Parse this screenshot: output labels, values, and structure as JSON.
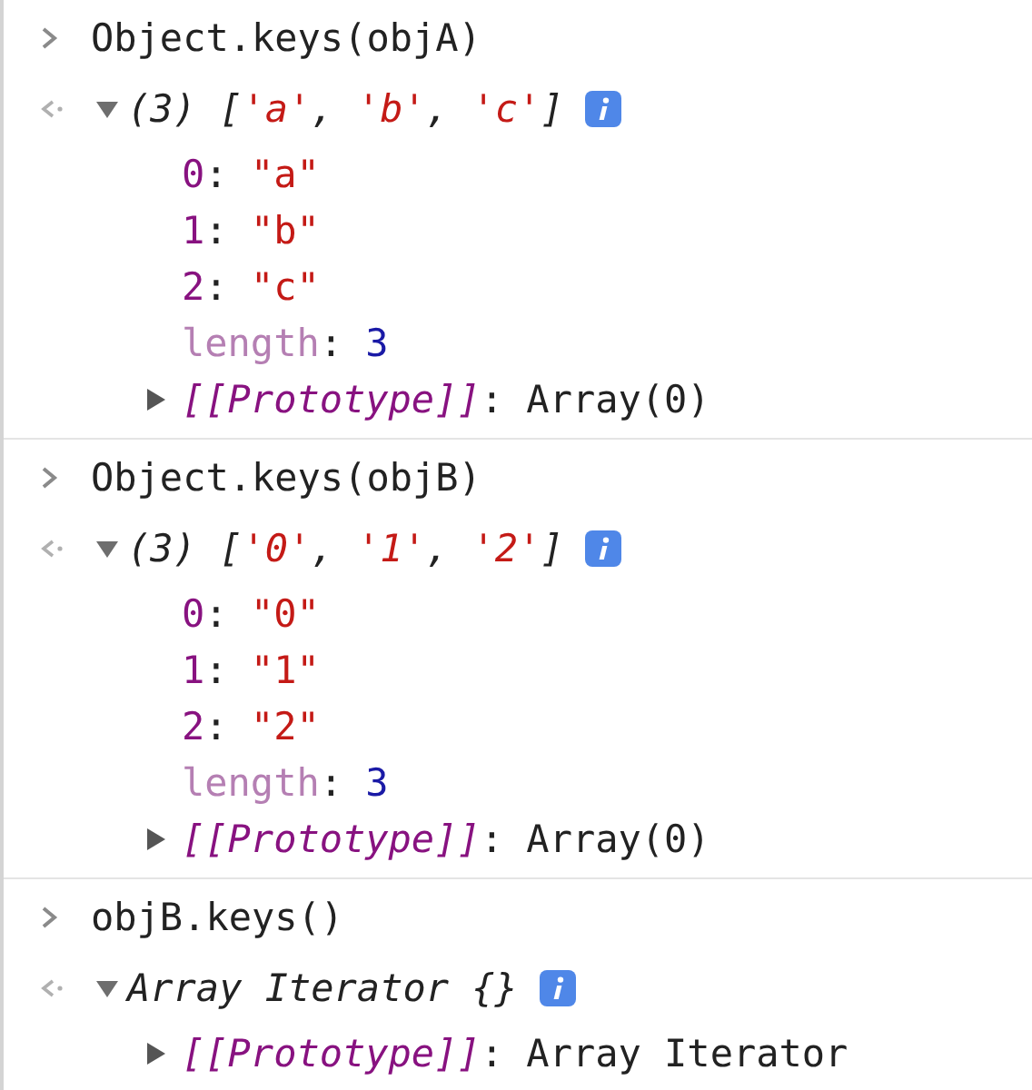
{
  "entries": [
    {
      "command": "Object.keys(objA)",
      "result": {
        "expanded": true,
        "summary": [
          {
            "text": "(3) [",
            "kind": "text"
          },
          {
            "text": "'a'",
            "kind": "string"
          },
          {
            "text": ", ",
            "kind": "text"
          },
          {
            "text": "'b'",
            "kind": "string"
          },
          {
            "text": ", ",
            "kind": "text"
          },
          {
            "text": "'c'",
            "kind": "string"
          },
          {
            "text": "]",
            "kind": "text"
          }
        ],
        "properties": [
          {
            "key": "0",
            "colon": ":",
            "value": "\"a\"",
            "kind": "string",
            "enumerable": true
          },
          {
            "key": "1",
            "colon": ":",
            "value": "\"b\"",
            "kind": "string",
            "enumerable": true
          },
          {
            "key": "2",
            "colon": ":",
            "value": "\"c\"",
            "kind": "string",
            "enumerable": true
          },
          {
            "key": "length",
            "colon": ":",
            "value": "3",
            "kind": "number",
            "enumerable": false
          },
          {
            "key": "[[Prototype]]",
            "colon": ":",
            "value": "Array(0)",
            "kind": "prototype",
            "expanded": false
          }
        ]
      }
    },
    {
      "command": "Object.keys(objB)",
      "result": {
        "expanded": true,
        "summary": [
          {
            "text": "(3) [",
            "kind": "text"
          },
          {
            "text": "'0'",
            "kind": "string"
          },
          {
            "text": ", ",
            "kind": "text"
          },
          {
            "text": "'1'",
            "kind": "string"
          },
          {
            "text": ", ",
            "kind": "text"
          },
          {
            "text": "'2'",
            "kind": "string"
          },
          {
            "text": "]",
            "kind": "text"
          }
        ],
        "properties": [
          {
            "key": "0",
            "colon": ":",
            "value": "\"0\"",
            "kind": "string",
            "enumerable": true
          },
          {
            "key": "1",
            "colon": ":",
            "value": "\"1\"",
            "kind": "string",
            "enumerable": true
          },
          {
            "key": "2",
            "colon": ":",
            "value": "\"2\"",
            "kind": "string",
            "enumerable": true
          },
          {
            "key": "length",
            "colon": ":",
            "value": "3",
            "kind": "number",
            "enumerable": false
          },
          {
            "key": "[[Prototype]]",
            "colon": ":",
            "value": "Array(0)",
            "kind": "prototype",
            "expanded": false
          }
        ]
      }
    },
    {
      "command": "objB.keys()",
      "result": {
        "expanded": true,
        "summary": [
          {
            "text": "Array Iterator {}",
            "kind": "text"
          }
        ],
        "properties": [
          {
            "key": "[[Prototype]]",
            "colon": ":",
            "value": "Array Iterator",
            "kind": "prototype",
            "expanded": false
          }
        ]
      }
    }
  ]
}
